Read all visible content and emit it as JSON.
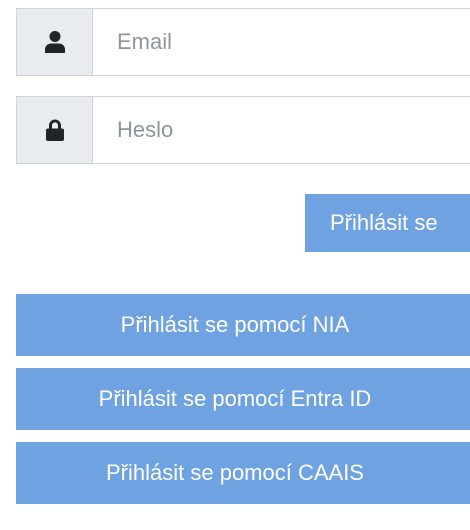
{
  "login_form": {
    "email": {
      "placeholder": "Email",
      "value": "",
      "icon": "user-icon"
    },
    "password": {
      "placeholder": "Heslo",
      "value": "",
      "icon": "lock-icon"
    },
    "submit_label": "Přihlásit se"
  },
  "sso": {
    "nia_label": "Přihlásit se pomocí NIA",
    "entra_label": "Přihlásit se pomocí Entra ID",
    "caais_label": "Přihlásit se pomocí CAAIS"
  },
  "colors": {
    "primary_button": "#6fa2e0",
    "addon_background": "#e9ecef",
    "border": "#ced4da",
    "placeholder": "#8e959c"
  }
}
